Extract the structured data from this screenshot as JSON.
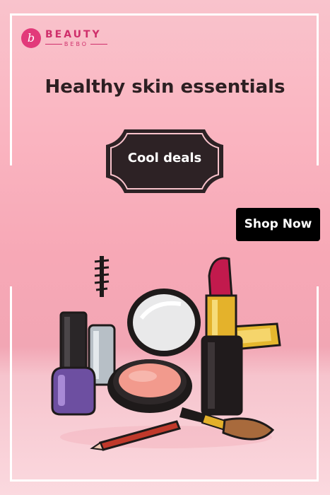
{
  "brand": {
    "logo_letter": "b",
    "name": "BEAUTY",
    "sub": "BEBO"
  },
  "headline": "Healthy skin essentials",
  "badge_text": "Cool deals",
  "cta_label": "Shop Now",
  "colors": {
    "background_top": "#f9c3cc",
    "background_bottom": "#fbd9df",
    "brand": "#cf2f6b",
    "badge": "#2d2225",
    "cta": "#000000"
  },
  "illustration_items": [
    "nail-polish",
    "mascara",
    "compact-mirror",
    "blush-compact",
    "lipstick",
    "lip-pencil",
    "makeup-brush"
  ]
}
